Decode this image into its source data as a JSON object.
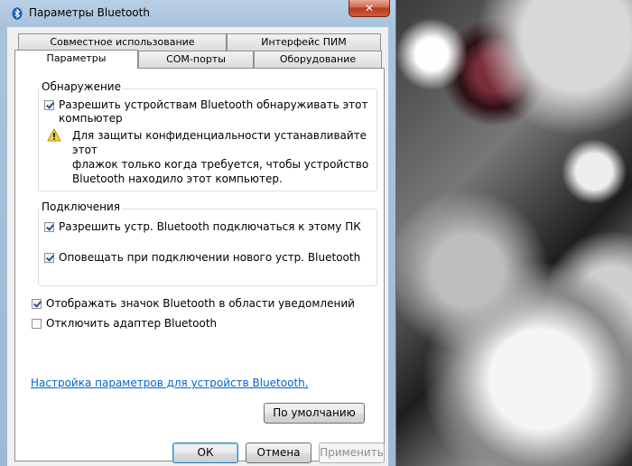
{
  "window": {
    "title": "Параметры Bluetooth",
    "close_label": "✕"
  },
  "tabs": {
    "row1": [
      {
        "label": "Совместное использование"
      },
      {
        "label": "Интерфейс ПИМ"
      }
    ],
    "row2": [
      {
        "label": "Параметры",
        "active": true
      },
      {
        "label": "COM-порты"
      },
      {
        "label": "Оборудование"
      }
    ]
  },
  "discovery": {
    "group_label": "Обнаружение",
    "allow_discover": {
      "line1": "Разрешить устройствам Bluetooth обнаруживать этот",
      "line2": "компьютер",
      "checked": true
    },
    "warning": {
      "line1": "Для защиты конфиденциальности устанавливайте этот",
      "line2": "флажок только когда требуется, чтобы устройство",
      "line3": "Bluetooth находило этот компьютер."
    }
  },
  "connections": {
    "group_label": "Подключения",
    "allow_connect": {
      "label": "Разрешить устр. Bluetooth подключаться к этому ПК",
      "checked": true
    },
    "notify_connect": {
      "label": "Оповещать при подключении нового устр. Bluetooth",
      "checked": true
    }
  },
  "show_icon": {
    "label": "Отображать значок Bluetooth в области уведомлений",
    "checked": true
  },
  "disable_adapter": {
    "label": "Отключить адаптер Bluetooth",
    "checked": false
  },
  "link_text": "Настройка параметров для устройств Bluetooth.",
  "buttons": {
    "defaults": "По умолчанию",
    "ok": "ОК",
    "cancel": "Отмена",
    "apply": "Применить"
  },
  "colors": {
    "link": "#0066cc",
    "title_bar": "#a9c3dc",
    "close_button": "#c9452a"
  },
  "icons": {
    "title": "bluetooth-icon",
    "warning": "warning-triangle-icon"
  }
}
